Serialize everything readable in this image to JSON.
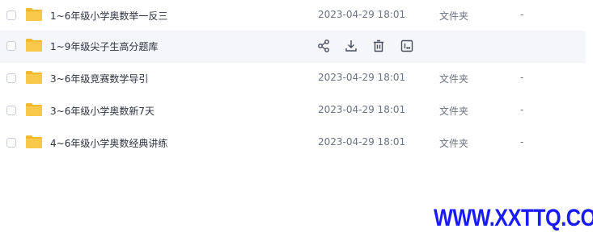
{
  "files": [
    {
      "name": "1~6年级小学奥数举一反三",
      "date": "2023-04-29 18:01",
      "type": "文件夹",
      "size": "-",
      "hover": false
    },
    {
      "name": "1~9年级尖子生高分题库",
      "date": "",
      "type": "",
      "size": "",
      "hover": true
    },
    {
      "name": "3~6年级竞赛数学导引",
      "date": "2023-04-29 18:01",
      "type": "文件夹",
      "size": "-",
      "hover": false
    },
    {
      "name": "3~6年级小学奥数新7天",
      "date": "2023-04-29 18:01",
      "type": "文件夹",
      "size": "-",
      "hover": false
    },
    {
      "name": "4~6年级小学奥数经典讲练",
      "date": "2023-04-29 18:01",
      "type": "文件夹",
      "size": "-",
      "hover": false
    }
  ],
  "hover_actions": [
    "share-icon",
    "download-icon",
    "delete-icon",
    "more-icon"
  ],
  "colors": {
    "folder": "#f8c84a",
    "folder_back": "#f1b92e",
    "hover_bg": "#f5f6f9",
    "icon": "#454b58",
    "watermark": "#1a1aff"
  },
  "watermark": "WWW.XXTTQ.COM"
}
